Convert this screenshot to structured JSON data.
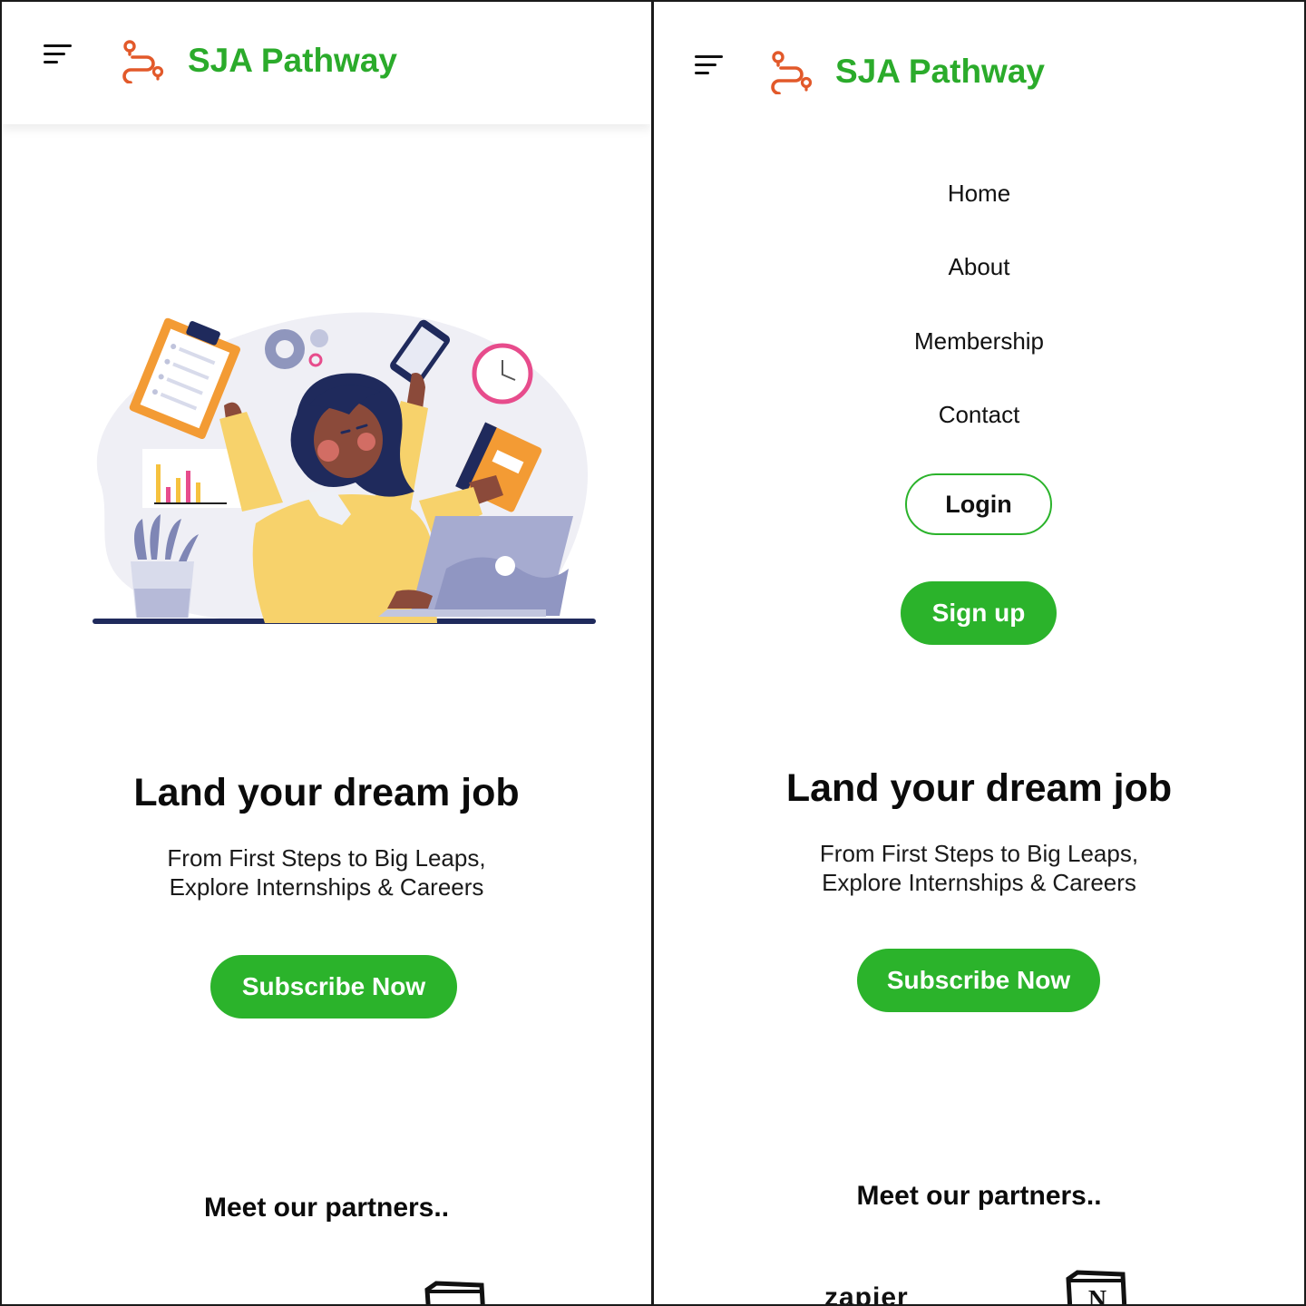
{
  "brand": {
    "name": "SJA Pathway"
  },
  "icons": {
    "menu": "menu-icon",
    "logo": "route-pin-icon"
  },
  "colors": {
    "accent_green": "#2bb32b",
    "logo_orange": "#e2592a"
  },
  "nav": {
    "items": [
      {
        "label": "Home"
      },
      {
        "label": "About"
      },
      {
        "label": "Membership"
      },
      {
        "label": "Contact"
      }
    ],
    "login_label": "Login",
    "signup_label": "Sign up"
  },
  "hero": {
    "headline": "Land your dream job",
    "subline_1": "From First Steps to Big Leaps,",
    "subline_2": "Explore Internships & Careers",
    "cta_label": "Subscribe Now"
  },
  "partners": {
    "heading": "Meet our partners..",
    "logos": [
      {
        "name": "zapier"
      },
      {
        "name": "N"
      }
    ]
  }
}
